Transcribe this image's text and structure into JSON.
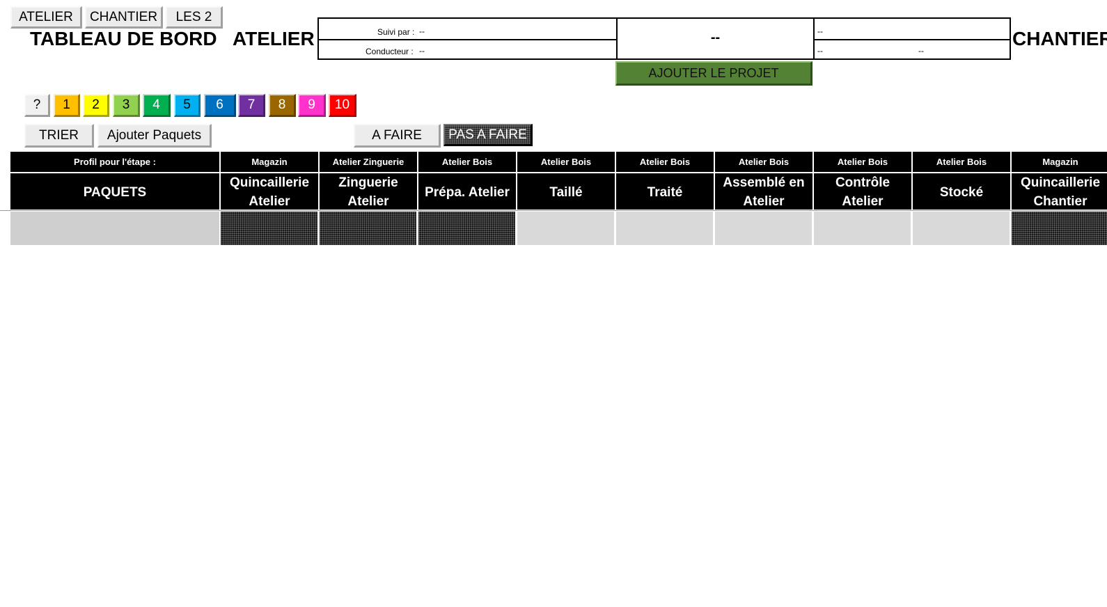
{
  "view_buttons": [
    "ATELIER",
    "CHANTIER",
    "LES 2"
  ],
  "title": "TABLEAU DE BORD",
  "atelier_label": "ATELIER",
  "chantier_label": "CHANTIER",
  "info": {
    "suivi_label": "Suivi par :",
    "suivi_value": "--",
    "conducteur_label": "Conducteur :",
    "conducteur_value": "--",
    "center_value": "--",
    "right_top": "--",
    "right_bottom_left": "--",
    "right_bottom_right": "--"
  },
  "add_project_label": "AJOUTER LE PROJET",
  "swatches": [
    {
      "label": "?",
      "color": "#f0f0f0"
    },
    {
      "label": "1",
      "color": "#ffc000"
    },
    {
      "label": "2",
      "color": "#ffff00"
    },
    {
      "label": "3",
      "color": "#92d050"
    },
    {
      "label": "4",
      "color": "#00b050"
    },
    {
      "label": "5",
      "color": "#00b0f0"
    },
    {
      "label": "6",
      "color": "#0070c0"
    },
    {
      "label": "7",
      "color": "#7030a0"
    },
    {
      "label": "8",
      "color": "#996600"
    },
    {
      "label": "9",
      "color": "#ff33cc"
    },
    {
      "label": "10",
      "color": "#ff0000"
    }
  ],
  "trier_label": "TRIER",
  "ajouter_paquets_label": "Ajouter Paquets",
  "a_faire_label": "A FAIRE",
  "pas_a_faire_label": "PAS A FAIRE",
  "table": {
    "profile_header": "Profil pour l'étape :",
    "paquets_header": "PAQUETS",
    "columns": [
      {
        "group": "Magazin",
        "step": "Quincaillerie Atelier",
        "state": "pattern"
      },
      {
        "group": "Atelier Zinguerie",
        "step": "Zinguerie Atelier",
        "state": "pattern"
      },
      {
        "group": "Atelier Bois",
        "step": "Prépa. Atelier",
        "state": "pattern"
      },
      {
        "group": "Atelier Bois",
        "step": "Taillé",
        "state": "empty"
      },
      {
        "group": "Atelier Bois",
        "step": "Traité",
        "state": "empty"
      },
      {
        "group": "Atelier Bois",
        "step": "Assemblé en Atelier",
        "state": "empty"
      },
      {
        "group": "Atelier Bois",
        "step": "Contrôle Atelier",
        "state": "empty"
      },
      {
        "group": "Atelier Bois",
        "step": "Stocké",
        "state": "empty"
      },
      {
        "group": "Magazin",
        "step": "Quincaillerie Chantier",
        "state": "pattern"
      }
    ]
  }
}
